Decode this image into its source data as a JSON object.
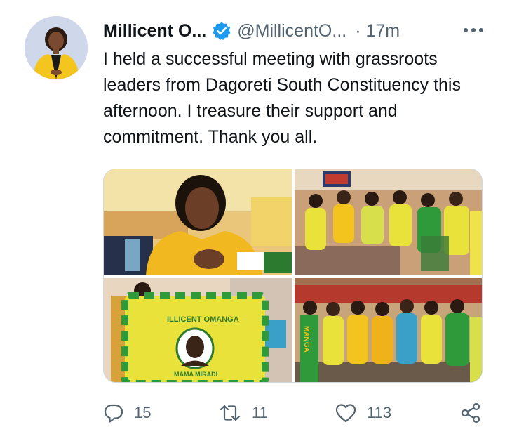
{
  "tweet": {
    "display_name": "Millicent O...",
    "handle": "@MillicentO...",
    "time": "· 17m",
    "text": "I held a successful meeting with grassroots leaders from Dagoreti South Constituency this afternoon. I treasure their support and commitment. Thank you all.",
    "verified": true,
    "more_icon": "more-horizontal-icon"
  },
  "photos": [
    {
      "name": "woman-in-yellow-smiling"
    },
    {
      "name": "group-of-women-supporters"
    },
    {
      "name": "supporter-holding-campaign-banner",
      "banner_text": "ILLICENT OMANGA",
      "banner_sub": "MAMA MIRADI"
    },
    {
      "name": "group-photo-women-in-green-and-yellow",
      "scarf_text": "MANGA"
    }
  ],
  "actions": {
    "reply_count": "15",
    "retweet_count": "11",
    "like_count": "113"
  },
  "colors": {
    "text": "#0f1419",
    "secondary": "#536471",
    "verified": "#1d9bf0",
    "yellow": "#f2c41d",
    "green": "#2e9a3a"
  }
}
